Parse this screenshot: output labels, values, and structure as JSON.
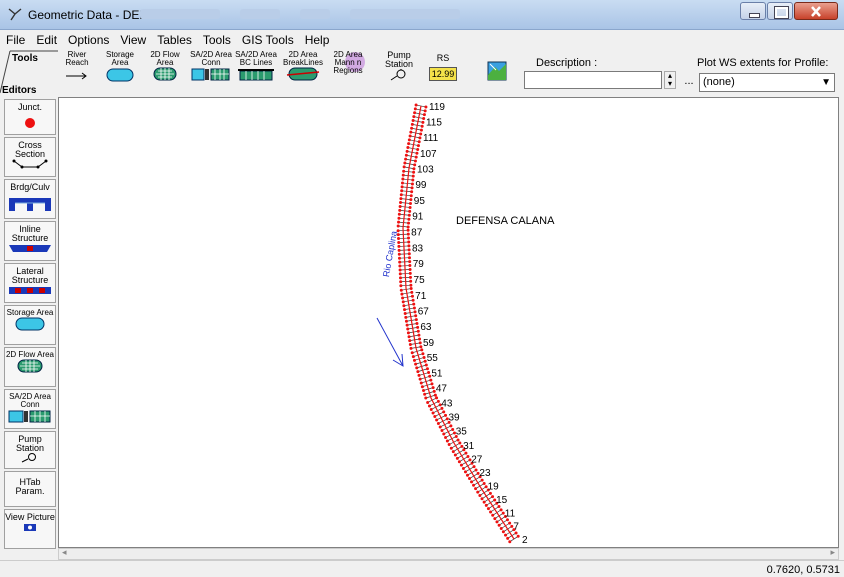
{
  "window": {
    "title": "Geometric Data - DEFENSA",
    "minimize_label": "−",
    "maximize_label": "□",
    "close_label": "✕"
  },
  "menu": [
    "File",
    "Edit",
    "Options",
    "View",
    "Tables",
    "Tools",
    "GIS Tools",
    "Help"
  ],
  "toolbar": {
    "tools_label": "Tools",
    "editors_label": "Editors",
    "buttons": [
      {
        "label": "River Reach",
        "icon": "river-reach-icon"
      },
      {
        "label": "Storage Area",
        "icon": "storage-area-icon"
      },
      {
        "label": "2D Flow Area",
        "icon": "2d-flow-area-icon"
      },
      {
        "label": "SA/2D Area Conn",
        "icon": "sa-2d-conn-icon"
      },
      {
        "label": "SA/2D Area BC Lines",
        "icon": "bc-lines-icon"
      },
      {
        "label": "2D Area BreakLines",
        "icon": "breaklines-icon"
      },
      {
        "label": "2D Area Mann n Regions",
        "icon": "mann-n-regions-icon"
      },
      {
        "label": "Pump Station",
        "icon": "pump-station-icon"
      },
      {
        "label": "RS",
        "icon": "rs-icon",
        "badge": "12.99"
      },
      {
        "label": "",
        "icon": "map-icon"
      }
    ],
    "description_label": "Description :",
    "description_value": "",
    "dots_label": "...",
    "plot_ws_label": "Plot WS extents for Profile:",
    "plot_ws_value": "(none)"
  },
  "editors": [
    {
      "label": "Junct.",
      "icon": "junction-icon"
    },
    {
      "label": "Cross Section",
      "icon": "cross-section-icon"
    },
    {
      "label": "Brdg/Culv",
      "icon": "bridge-culvert-icon"
    },
    {
      "label": "Inline Structure",
      "icon": "inline-structure-icon"
    },
    {
      "label": "Lateral Structure",
      "icon": "lateral-structure-icon"
    },
    {
      "label": "Storage Area",
      "icon": "storage-area-icon"
    },
    {
      "label": "2D Flow Area",
      "icon": "2d-flow-area-icon"
    },
    {
      "label": "SA/2D Area Conn",
      "icon": "sa-2d-conn-icon"
    },
    {
      "label": "Pump Station",
      "icon": "pump-station-icon"
    },
    {
      "label": "HTab Param.",
      "icon": "htab-icon"
    },
    {
      "label": "View Picture",
      "icon": "camera-icon"
    }
  ],
  "map": {
    "reach_label": "DEFENSA CALANA",
    "river_label": "Rio Caplina",
    "station_labels": [
      "119",
      "115",
      "111",
      "107",
      "103",
      "99",
      "95",
      "91",
      "87",
      "83",
      "79",
      "75",
      "71",
      "67",
      "63",
      "59",
      "55",
      "51",
      "47",
      "43",
      "39",
      "35",
      "31",
      "27",
      "23",
      "19",
      "15",
      "11",
      "7",
      "2"
    ],
    "reach_color": "#e11",
    "arrow_color": "#2233cc"
  },
  "status": {
    "coords": "0.7620, 0.5731"
  }
}
